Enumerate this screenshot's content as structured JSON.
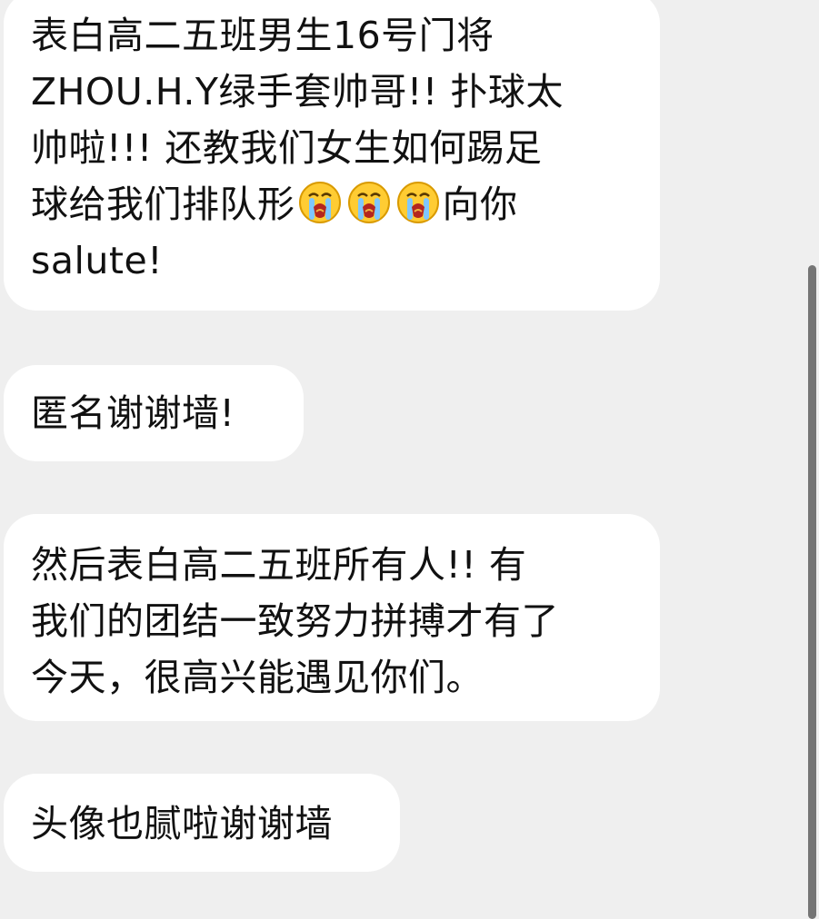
{
  "messages": [
    {
      "lines": [
        "表白高二五班男生16号门将",
        "ZHOU.H.Y绿手套帅哥!! 扑球太",
        "帅啦!!! 还教我们女生如何踢足",
        "球给我们排队形",
        "salute!"
      ],
      "line4_suffix": "向你",
      "emoji": "crying-face-icon"
    },
    {
      "lines": [
        "匿名谢谢墙!"
      ]
    },
    {
      "lines": [
        "然后表白高二五班所有人!! 有",
        "我们的团结一致努力拼搏才有了",
        "今天，很高兴能遇见你们。"
      ]
    },
    {
      "lines": [
        "头像也腻啦谢谢墙"
      ]
    }
  ],
  "colors": {
    "background": "#efefef",
    "bubble": "#ffffff",
    "text": "#111111",
    "scrollbar": "#757575",
    "emoji_face": "#ffcc33"
  }
}
